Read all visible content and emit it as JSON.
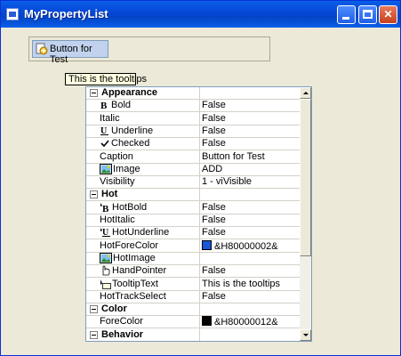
{
  "window": {
    "title": "MyPropertyList"
  },
  "colors": {
    "titlebar": "#0a5fe8",
    "hotforecolor_swatch": "#1a56d6",
    "forecolor_swatch": "#000000"
  },
  "test_button": {
    "label": "Button for Test"
  },
  "tooltip": {
    "text": "This is the tooltips"
  },
  "property_list": {
    "rows": [
      {
        "type": "category",
        "name": "Appearance"
      },
      {
        "type": "prop",
        "name": "Bold",
        "value": "False",
        "icon": "bold-icon"
      },
      {
        "type": "prop",
        "name": "Italic",
        "value": "False"
      },
      {
        "type": "prop",
        "name": "Underline",
        "value": "False",
        "icon": "underline-icon"
      },
      {
        "type": "prop",
        "name": "Checked",
        "value": "False",
        "icon": "checkmark-icon"
      },
      {
        "type": "prop",
        "name": "Caption",
        "value": "Button for Test"
      },
      {
        "type": "prop",
        "name": "Image",
        "value": "ADD",
        "icon": "image-icon"
      },
      {
        "type": "prop",
        "name": "Visibility",
        "value": "1 - viVisible"
      },
      {
        "type": "category",
        "name": "Hot"
      },
      {
        "type": "prop",
        "name": "HotBold",
        "value": "False",
        "icon": "hot-bold-icon"
      },
      {
        "type": "prop",
        "name": "HotItalic",
        "value": "False"
      },
      {
        "type": "prop",
        "name": "HotUnderline",
        "value": "False",
        "icon": "hot-underline-icon"
      },
      {
        "type": "prop",
        "name": "HotForeColor",
        "value": "&H80000002&",
        "swatch": "#1a56d6"
      },
      {
        "type": "prop",
        "name": "HotImage",
        "value": "",
        "icon": "image-icon"
      },
      {
        "type": "prop",
        "name": "HandPointer",
        "value": "False",
        "icon": "hand-pointer-icon"
      },
      {
        "type": "prop",
        "name": "TooltipText",
        "value": "This is the tooltips",
        "icon": "tooltip-icon"
      },
      {
        "type": "prop",
        "name": "HotTrackSelect",
        "value": "False"
      },
      {
        "type": "category",
        "name": "Color"
      },
      {
        "type": "prop",
        "name": "ForeColor",
        "value": "&H80000012&",
        "swatch": "#000000"
      },
      {
        "type": "category",
        "name": "Behavior"
      }
    ]
  }
}
